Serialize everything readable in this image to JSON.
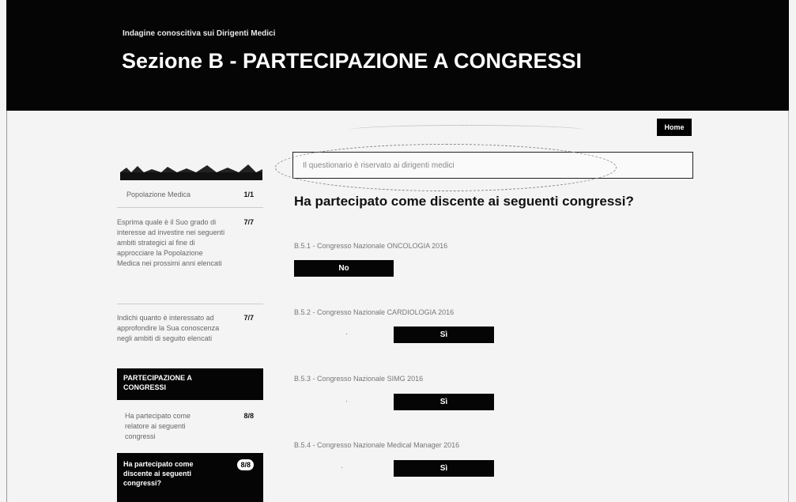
{
  "header": {
    "subtitle": "Indagine conoscitiva sui Dirigenti Medici",
    "title": "Sezione B - PARTECIPAZIONE A CONGRESSI"
  },
  "nav": {
    "home_label": "Home"
  },
  "info_box": {
    "text": "Il questionario è riservato ai dirigenti medici"
  },
  "main": {
    "question_title": "Ha partecipato come discente ai seguenti congressi?",
    "items": [
      {
        "label": "B.5.1 - Congresso Nazionale ONCOLOGIA 2016",
        "answer": "No"
      },
      {
        "label": "B.5.2 - Congresso Nazionale CARDIOLOGIA 2016",
        "answer": "Sì"
      },
      {
        "label": "B.5.3 - Congresso Nazionale SIMG 2016",
        "answer": "Sì"
      },
      {
        "label": "B.5.4 - Congresso Nazionale Medical Manager 2016",
        "answer": "Sì"
      }
    ]
  },
  "sidebar": {
    "items": [
      {
        "text": "Popolazione Medica",
        "count": "1/1"
      },
      {
        "text": "Esprima quale è il Suo grado di interesse ad investire nei seguenti ambiti strategici al fine di approcciare la Popolazione Medica nei prossimi anni elencati",
        "count": "7/7"
      },
      {
        "text": "Indichi quanto è interessato ad approfondire la Sua conoscenza negli ambiti di seguito elencati",
        "count": "7/7"
      },
      {
        "text": "PARTECIPAZIONE A CONGRESSI",
        "count": ""
      },
      {
        "text": "Ha partecipato come relatore ai seguenti congressi",
        "count": "8/8"
      },
      {
        "text": "Ha partecipato come discente ai seguenti congressi?",
        "count": "8/8"
      }
    ]
  },
  "colors": {
    "header_bg": "#050505",
    "button_bg": "#050505",
    "page_bg": "#f4f4f4"
  }
}
